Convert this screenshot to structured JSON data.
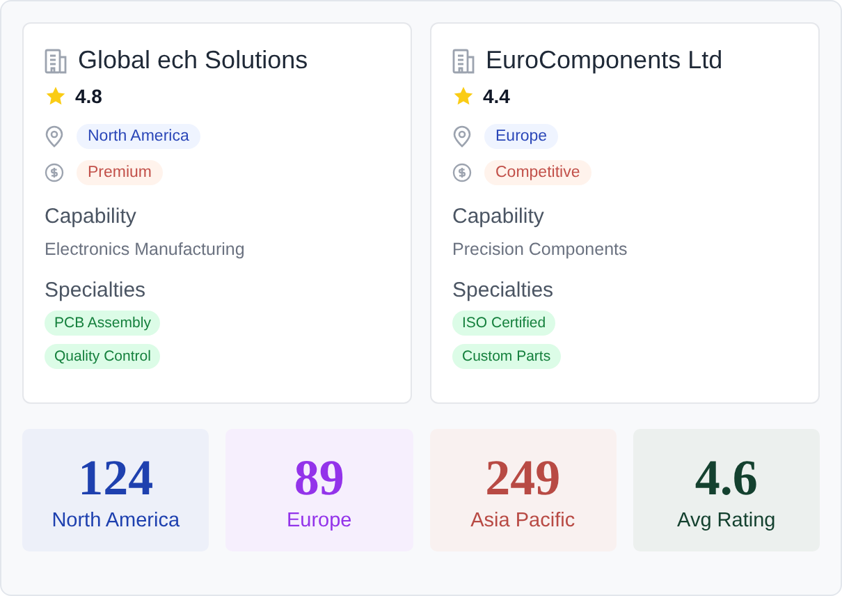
{
  "suppliers": [
    {
      "name": "Global ech Solutions",
      "rating": "4.8",
      "region": "North America",
      "pricing": "Premium",
      "capability_label": "Capability",
      "capability": "Electronics Manufacturing",
      "specialties_label": "Specialties",
      "specialties": [
        "PCB Assembly",
        "Quality Control"
      ]
    },
    {
      "name": "EuroComponents Ltd",
      "rating": "4.4",
      "region": "Europe",
      "pricing": "Competitive",
      "capability_label": "Capability",
      "capability": "Precision Components",
      "specialties_label": "Specialties",
      "specialties": [
        "ISO Certified",
        "Custom Parts"
      ]
    }
  ],
  "stats": [
    {
      "value": "124",
      "label": "North America",
      "color": "#1e40af"
    },
    {
      "value": "89",
      "label": "Europe",
      "color": "#9333ea"
    },
    {
      "value": "249",
      "label": "Asia Pacific",
      "color": "#b84a44"
    },
    {
      "value": "4.6",
      "label": "Avg Rating",
      "color": "#14412f"
    }
  ]
}
